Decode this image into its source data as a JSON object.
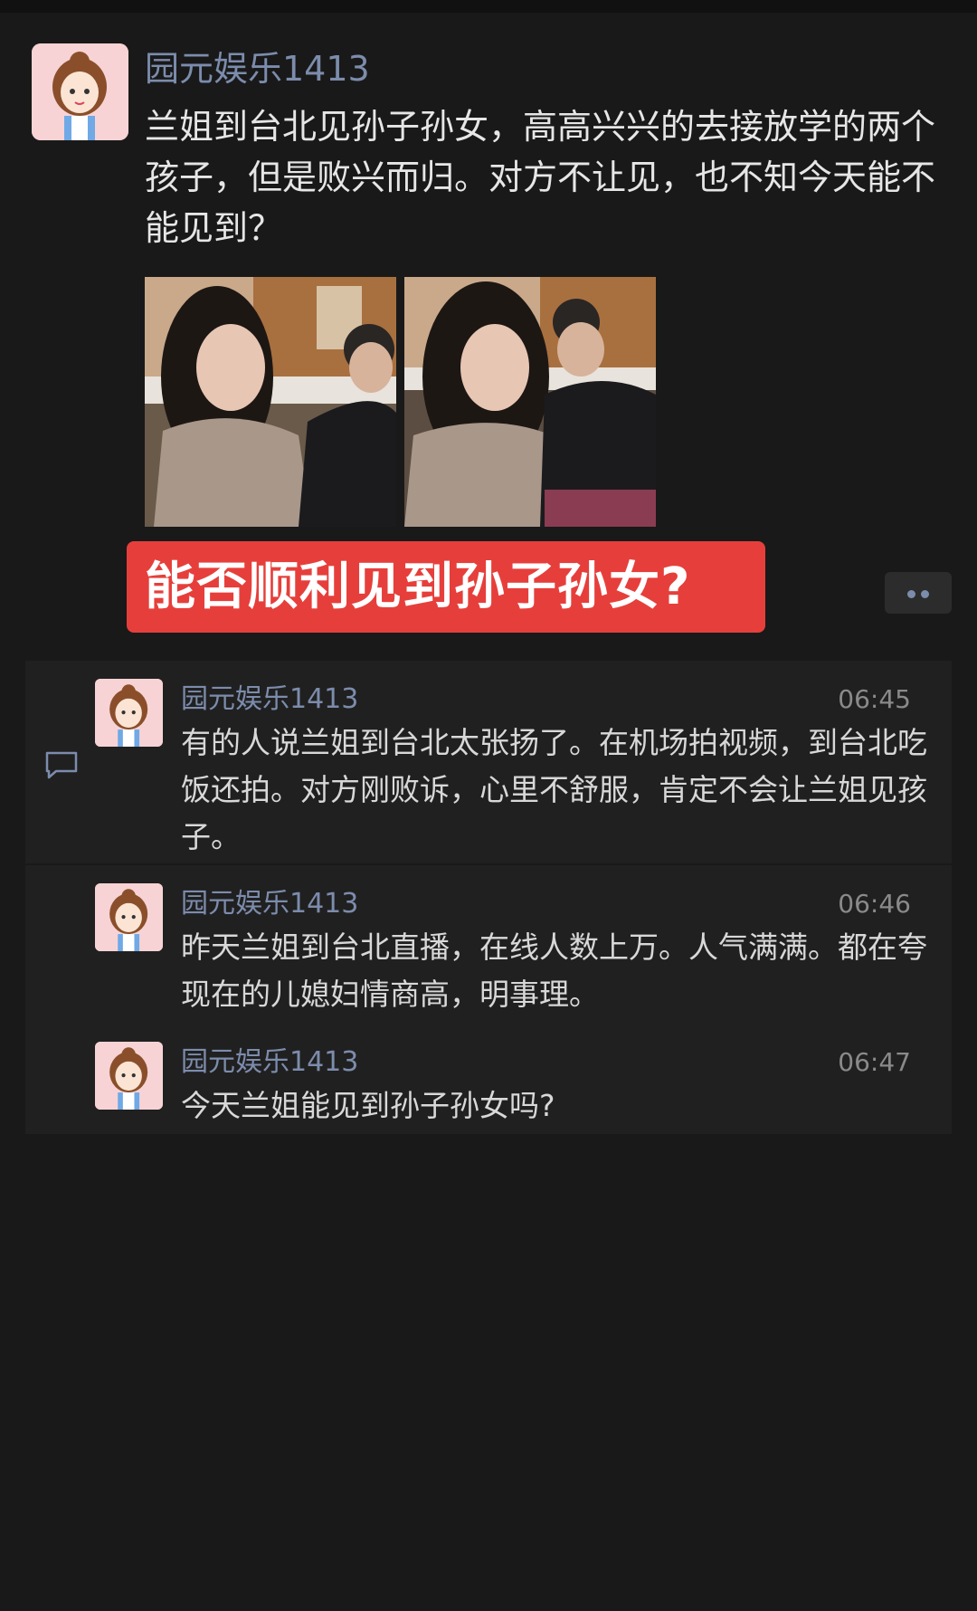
{
  "post": {
    "author": "园元娱乐1413",
    "text": "兰姐到台北见孙子孙女，高高兴兴的去接放学的两个孩子，但是败兴而归。对方不让见，也不知今天能不能见到？",
    "caption": "能否顺利见到孙子孙女?"
  },
  "comments": [
    {
      "author": "园元娱乐1413",
      "time": "06:45",
      "text": "有的人说兰姐到台北太张扬了。在机场拍视频，到台北吃饭还拍。对方刚败诉，心里不舒服，肯定不会让兰姐见孩子。"
    },
    {
      "author": "园元娱乐1413",
      "time": "06:46",
      "text": "昨天兰姐到台北直播，在线人数上万。人气满满。都在夸现在的儿媳妇情商高，明事理。"
    },
    {
      "author": "园元娱乐1413",
      "time": "06:47",
      "text": "今天兰姐能见到孙子孙女吗?"
    }
  ],
  "colors": {
    "background": "#191919",
    "name_link": "#7c8cac",
    "caption_red": "#e63f3b",
    "comment_panel": "#202020"
  },
  "icons": [
    "comment-icon",
    "more-dots-icon"
  ]
}
